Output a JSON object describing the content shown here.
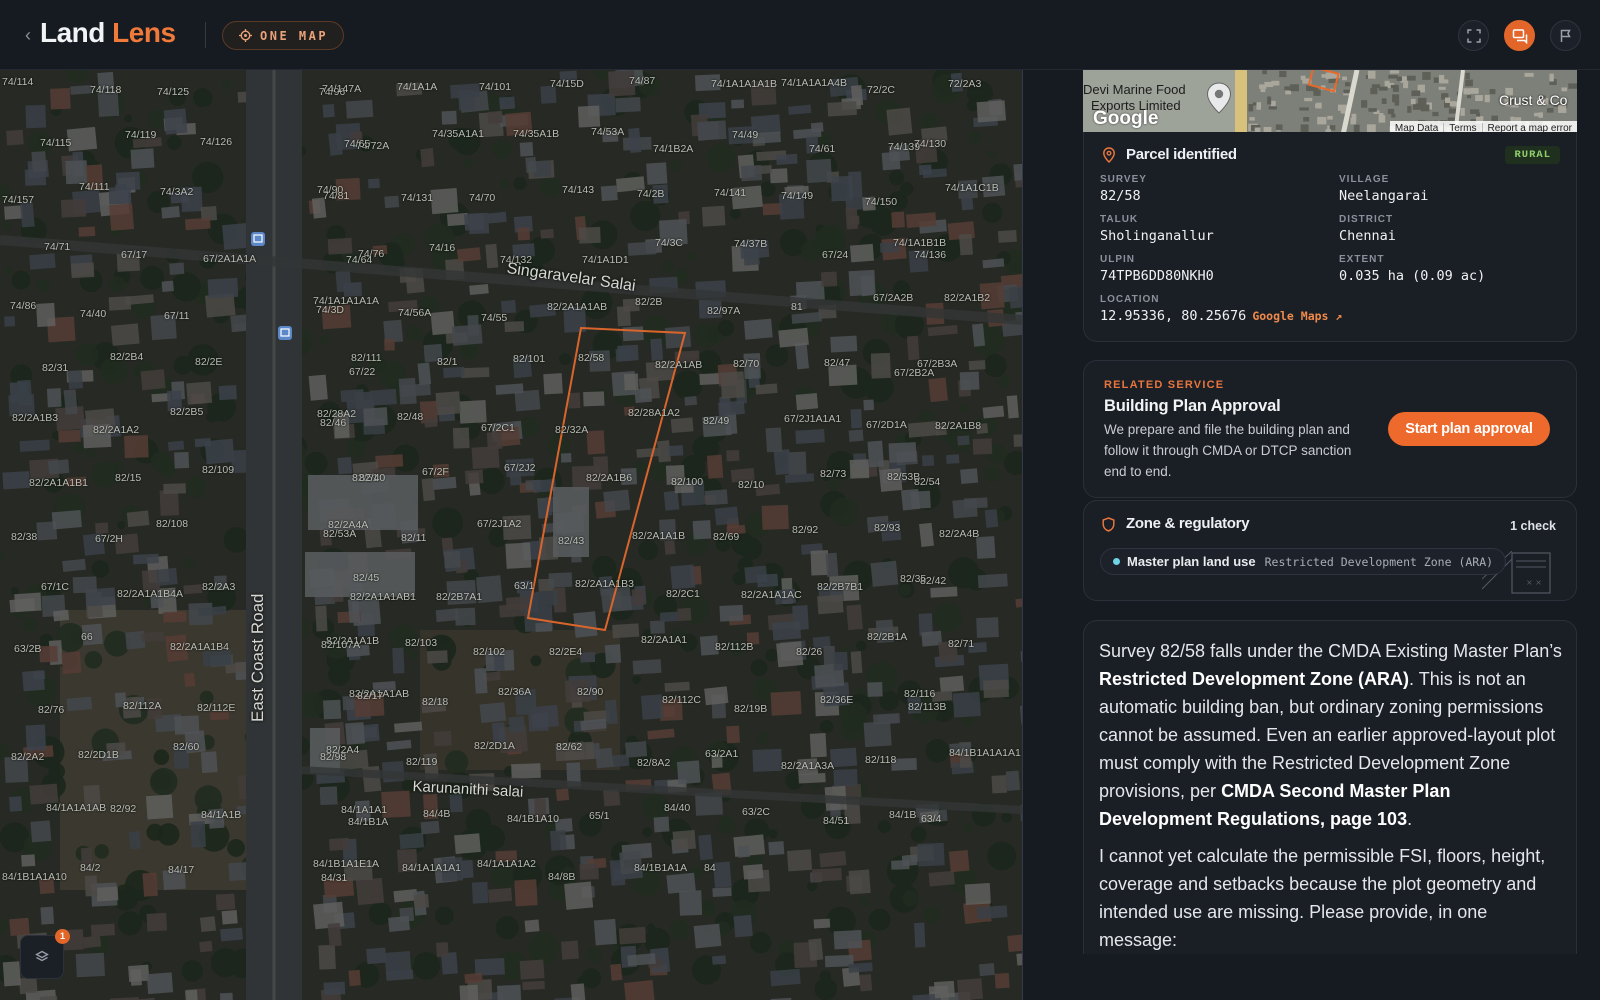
{
  "header": {
    "logo_word1": "Land",
    "logo_word2": "Lens",
    "mode_pill": "ONE MAP"
  },
  "map": {
    "road_labels": [
      "East Coast Road",
      "Singaravelar Salai",
      "Karunanithi salai"
    ],
    "parcel_labels": [
      "74/114",
      "74/118",
      "74/125",
      "74/96",
      "74/147A",
      "74/1A1A",
      "74/101",
      "74/15D",
      "74/87",
      "74/1A1A1A1B",
      "74/1A1A1A4B",
      "72/2C",
      "72/2A3",
      "74/115",
      "74/119",
      "74/126",
      "74/72A",
      "74/65",
      "74/35A1A1",
      "74/35A1B",
      "74/53A",
      "74/1B2A",
      "74/49",
      "74/61",
      "74/139",
      "74/130",
      "74/157",
      "74/111",
      "74/3A2",
      "74/90",
      "74/81",
      "74/131",
      "74/70",
      "74/143",
      "74/2B",
      "74/141",
      "74/149",
      "74/150",
      "74/1A1C1B",
      "74/71",
      "67/17",
      "67/2A1A1A",
      "74/76",
      "74/64",
      "74/16",
      "74/132",
      "74/1A1D1",
      "74/3C",
      "74/37B",
      "67/24",
      "74/1A1B1B",
      "74/136",
      "74/86",
      "74/40",
      "67/11",
      "74/3D",
      "74/1A1A1A1A",
      "74/56A",
      "74/55",
      "82/2A1A1AB",
      "82/2B",
      "82/97A",
      "81",
      "67/2A2B",
      "82/2A1B2",
      "82/31",
      "82/2B4",
      "82/2E",
      "82/111",
      "67/22",
      "82/1",
      "82/101",
      "82/58",
      "82/2A1AB",
      "82/70",
      "82/47",
      "67/2B2A",
      "67/2B3A",
      "82/2A1B3",
      "82/2A1A2",
      "82/2B5",
      "82/28A2",
      "82/46",
      "82/48",
      "67/2C1",
      "82/32A",
      "82/28A1A2",
      "82/49",
      "67/2J1A1A1",
      "67/2D1A",
      "82/2A1B8",
      "82/2A1A1B1",
      "82/15",
      "82/109",
      "82/51",
      "82/40",
      "67/2F",
      "67/2J2",
      "82/2A1B6",
      "82/100",
      "82/10",
      "82/73",
      "82/53B",
      "82/54",
      "82/38",
      "67/2H",
      "82/108",
      "82/53A",
      "82/2A4A",
      "82/11",
      "67/2J1A2",
      "82/43",
      "82/2A1A1B",
      "82/69",
      "82/92",
      "82/93",
      "82/2A4B",
      "67/1C",
      "82/2A1A1B4A",
      "82/2A3",
      "82/2A1A1AB1",
      "82/45",
      "82/2B7A1",
      "63/1",
      "82/2A1A1B3",
      "82/2C1",
      "82/2A1A1AC",
      "82/2B7B1",
      "82/35",
      "82/42",
      "63/2B",
      "66",
      "82/2A1A1B4",
      "82/2A1A1B",
      "82/107A",
      "82/103",
      "82/102",
      "82/2E4",
      "82/2A1A1",
      "82/112B",
      "82/26",
      "82/2B1A",
      "82/71",
      "82/76",
      "82/112A",
      "82/112E",
      "82/2A1A1AB",
      "82/17",
      "82/18",
      "82/36A",
      "82/90",
      "82/112C",
      "82/19B",
      "82/36E",
      "82/116",
      "82/113B",
      "82/2A2",
      "82/2D1B",
      "82/60",
      "82/98",
      "82/2A4",
      "82/119",
      "82/2D1A",
      "82/62",
      "82/8A2",
      "63/2A1",
      "82/2A1A3A",
      "82/118",
      "84/1B1A1A1A1",
      "84/1A1A1AB",
      "82/92",
      "84/1A1B",
      "84/1B1A",
      "84/1A1A1",
      "84/4B",
      "84/1B1A10",
      "65/1",
      "84/40",
      "63/2C",
      "84/51",
      "84/1B",
      "63/4",
      "84/1B1A1A10",
      "84/2",
      "84/17",
      "84/1B1A1E1A",
      "84/31",
      "84/1A1A1A1",
      "84/1A1A1A2",
      "84/8B",
      "84/1B1A1A",
      "84"
    ]
  },
  "minimap": {
    "label_devi": "Devi Marine Food",
    "label_exports": "Exports Limited",
    "label_crust": "Crust & Co",
    "google_text": "Google",
    "footer": [
      "Map Data",
      "Terms",
      "Report a map error"
    ]
  },
  "parcel": {
    "title": "Parcel identified",
    "badge": "RURAL",
    "fields": {
      "survey": {
        "label": "SURVEY",
        "value": "82/58"
      },
      "village": {
        "label": "VILLAGE",
        "value": "Neelangarai"
      },
      "taluk": {
        "label": "TALUK",
        "value": "Sholinganallur"
      },
      "district": {
        "label": "DISTRICT",
        "value": "Chennai"
      },
      "ulpin": {
        "label": "ULPIN",
        "value": "74TPB6DD80NKH0"
      },
      "extent": {
        "label": "EXTENT",
        "value": "0.035 ha (0.09 ac)"
      },
      "location": {
        "label": "LOCATION",
        "value": "12.95336, 80.25676"
      }
    },
    "maps_link": "Google Maps ↗"
  },
  "service": {
    "eyebrow": "RELATED SERVICE",
    "title": "Building Plan Approval",
    "description": "We prepare and file the building plan and follow it through CMDA or DTCP sanction end to end.",
    "cta": "Start plan approval"
  },
  "zone": {
    "title": "Zone & regulatory",
    "check_count": "1 check",
    "landuse_label": "Master plan land use",
    "landuse_value": "Restricted Development Zone (ARA)"
  },
  "message": {
    "p1_a": "Survey 82/58 falls under the CMDA Existing Master Plan’s ",
    "p1_b": "Restricted Development Zone (ARA)",
    "p1_c": ". This is not an automatic building ban, but ordinary zoning permissions cannot be assumed. Even an earlier approved-layout plot must comply with the Restricted Development Zone provisions, per ",
    "p1_d": "CMDA Second Master Plan Development Regulations, page 103",
    "p1_e": ".",
    "p2": "I cannot yet calculate the permissible FSI, floors, height, coverage and setbacks because the plot geometry and intended use are missing. Please provide, in one message:"
  },
  "layers": {
    "badge_count": "1"
  },
  "colors": {
    "accent": "#ee6a2c",
    "rural_badge": "#8fcf6b",
    "landuse_dot": "#6ed3e6",
    "panel_bg": "#161a21"
  }
}
